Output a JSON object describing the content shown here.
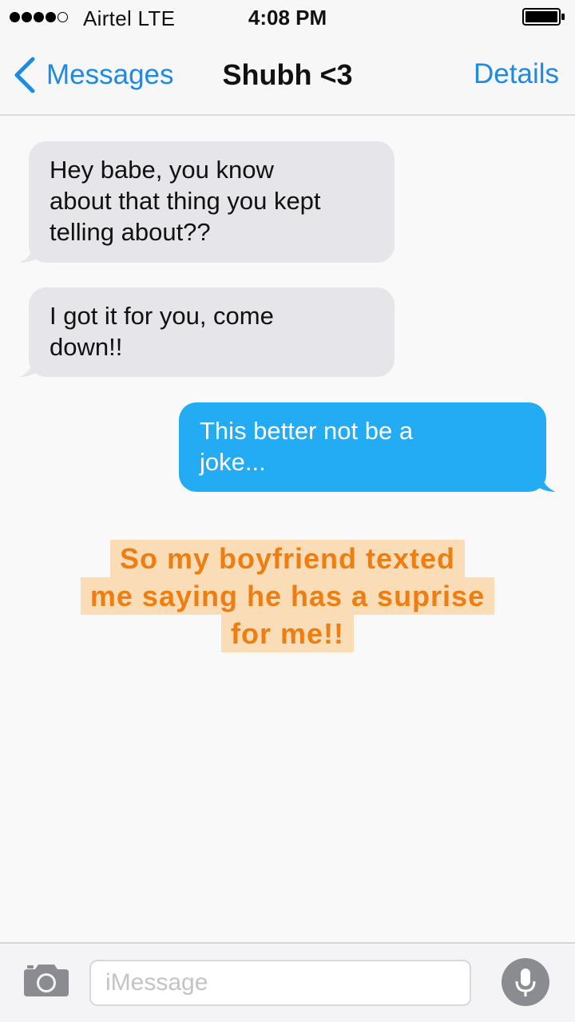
{
  "status_bar": {
    "carrier": "Airtel  LTE",
    "time": "4:08 PM",
    "signal_bars_filled": 4,
    "signal_bars_total": 5
  },
  "nav": {
    "back_label": "Messages",
    "title": "Shubh <3",
    "details_label": "Details"
  },
  "messages": [
    {
      "direction": "received",
      "text": "Hey babe, you know\nabout that thing you kept\ntelling about??"
    },
    {
      "direction": "received",
      "text": "I got it for you, come\ndown!!"
    },
    {
      "direction": "sent",
      "text": "This better not be a\njoke..."
    }
  ],
  "caption": {
    "lines": [
      "So my boyfriend texted",
      "me saying he has a suprise",
      "for me!!"
    ]
  },
  "input_bar": {
    "placeholder": "iMessage"
  },
  "colors": {
    "accent": "#1d8ae6",
    "sent_bubble": "#23abf4",
    "received_bubble": "#e5e5ea",
    "caption_text": "#ee7d12",
    "caption_highlight": "#faddb6"
  }
}
